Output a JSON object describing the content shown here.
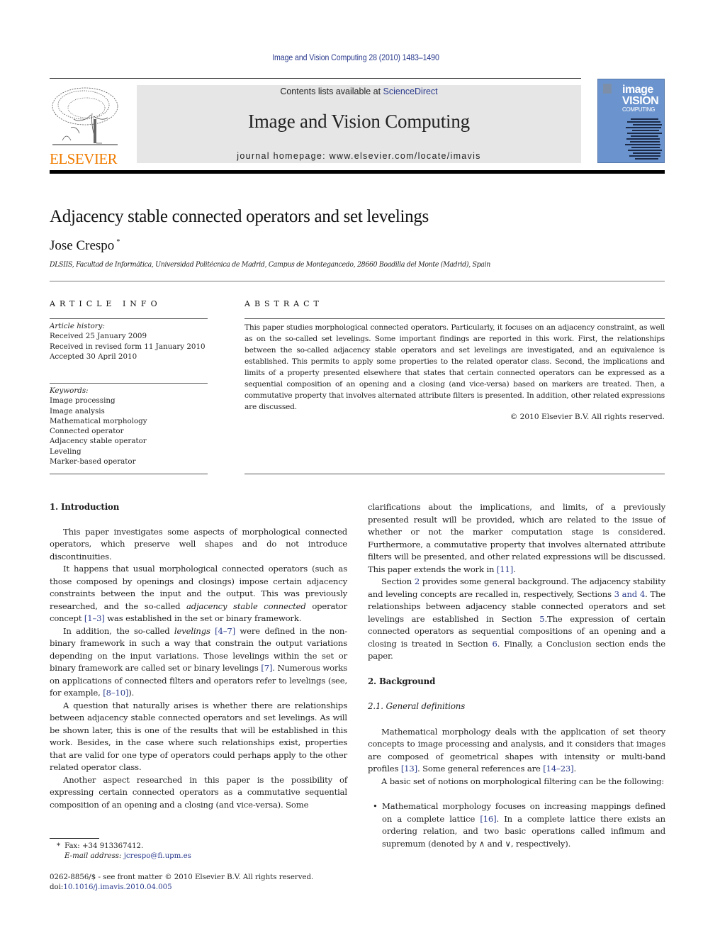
{
  "header": {
    "citation": "Image and Vision Computing 28 (2010) 1483–1490",
    "contents_prefix": "Contents lists available at ",
    "contents_link": "ScienceDirect",
    "journal_title": "Image and Vision Computing",
    "homepage": "journal homepage: www.elsevier.com/locate/imavis",
    "publisher_logo": "ELSEVIER",
    "cover": {
      "line1": "image",
      "line2": "VISION",
      "line3": "COMPUTING",
      "color": "#6b94cf"
    },
    "colors": {
      "link": "#2a3a8c",
      "elsevier_orange": "#f07c00",
      "banner_bg": "#e6e6e6"
    }
  },
  "article": {
    "title": "Adjacency stable connected operators and set levelings",
    "author": "Jose Crespo",
    "author_mark": "*",
    "affiliation": "DLSIIS, Facultad de Informática, Universidad Politécnica de Madrid, Campus de Montegancedo, 28660 Boadilla del Monte (Madrid), Spain"
  },
  "article_info": {
    "heading": "ARTICLE INFO",
    "history_label": "Article history:",
    "history": [
      "Received 25 January 2009",
      "Received in revised form 11 January 2010",
      "Accepted 30 April 2010"
    ],
    "keywords_label": "Keywords:",
    "keywords": [
      "Image processing",
      "Image analysis",
      "Mathematical morphology",
      "Connected operator",
      "Adjacency stable operator",
      "Leveling",
      "Marker-based operator"
    ]
  },
  "abstract": {
    "heading": "ABSTRACT",
    "text": "This paper studies morphological connected operators. Particularly, it focuses on an adjacency constraint, as well as on the so-called set levelings. Some important findings are reported in this work. First, the relationships between the so-called adjacency stable operators and set levelings are investigated, and an equivalence is established. This permits to apply some properties to the related operator class. Second, the implications and limits of a property presented elsewhere that states that certain connected operators can be expressed as a sequential composition of an opening and a closing (and vice-versa) based on markers are treated. Then, a commutative property that involves alternated attribute filters is presented. In addition, other related expressions are discussed.",
    "copyright": "© 2010 Elsevier B.V. All rights reserved."
  },
  "body": {
    "sec1_heading": "1. Introduction",
    "p1": "This paper investigates some aspects of morphological connected operators, which preserve well shapes and do not introduce discontinuities.",
    "p2_a": "It happens that usual morphological connected operators (such as those composed by openings and closings) impose certain adjacency constraints between the input and the output. This was previously researched, and the so-called ",
    "p2_em": "adjacency stable connected",
    "p2_b": " operator concept ",
    "p2_ref": "[1–3]",
    "p2_c": " was established in the set or binary framework.",
    "p3_a": "In addition, the so-called ",
    "p3_em": "levelings",
    "p3_ref1": "[4–7]",
    "p3_b": " were defined in the non-binary framework in such a way that constrain the output variations depending on the input variations. Those levelings within the set or binary framework are called set or binary levelings ",
    "p3_ref2": "[7]",
    "p3_c": ". Numerous works on applications of connected filters and operators refer to levelings (see, for example, ",
    "p3_ref3": "[8–10]",
    "p3_d": ").",
    "p4": "A question that naturally arises is whether there are relationships between adjacency stable connected operators and set levelings. As will be shown later, this is one of the results that will be established in this work. Besides, in the case where such relationships exist, properties that are valid for one type of operators could perhaps apply to the other related operator class.",
    "p5": "Another aspect researched in this paper is the possibility of expressing certain connected operators as a commutative sequential composition of an opening and a closing (and vice-versa). Some",
    "r1_a": "clarifications about the implications, and limits, of a previously presented result will be provided, which are related to the issue of whether or not the marker computation stage is considered. Furthermore, a commutative property that involves alternated attribute filters will be presented, and other related expressions will be discussed. This paper extends the work in ",
    "r1_ref": "[11]",
    "r1_b": ".",
    "r2_a": "Section ",
    "r2_ref1": "2",
    "r2_b": " provides some general background. The adjacency stability and leveling concepts are recalled in, respectively, Sections ",
    "r2_ref2": "3 and 4",
    "r2_c": ". The relationships between adjacency stable connected operators and set levelings are established in Section ",
    "r2_ref3": "5",
    "r2_d": ".The expression of certain connected operators as sequential compositions of an opening and a closing is treated in Section ",
    "r2_ref4": "6",
    "r2_e": ". Finally, a Conclusion section ends the paper.",
    "sec2_heading": "2. Background",
    "sec21_heading": "2.1. General definitions",
    "r3_a": "Mathematical morphology deals with the application of set theory concepts to image processing and analysis, and it considers that images are composed of geometrical shapes with intensity or multi-band profiles ",
    "r3_ref1": "[13]",
    "r3_b": ". Some general references are ",
    "r3_ref2": "[14–23]",
    "r3_c": ".",
    "r4": "A basic set of notions on morphological filtering can be the following:",
    "bullet_a": "Mathematical morphology focuses on increasing mappings defined on a complete lattice ",
    "bullet_ref": "[16]",
    "bullet_b": ". In a complete lattice there exists an ordering relation, and two basic operations called infimum and supremum (denoted by ∧ and ∨, respectively)."
  },
  "footer": {
    "fn_mark": "*",
    "fax": "Fax: +34 913367412.",
    "email_label": "E-mail address:",
    "email": "jcrespo@fi.upm.es",
    "imprint": "0262-8856/$ - see front matter © 2010 Elsevier B.V. All rights reserved.",
    "doi_label": "doi:",
    "doi": "10.1016/j.imavis.2010.04.005"
  }
}
